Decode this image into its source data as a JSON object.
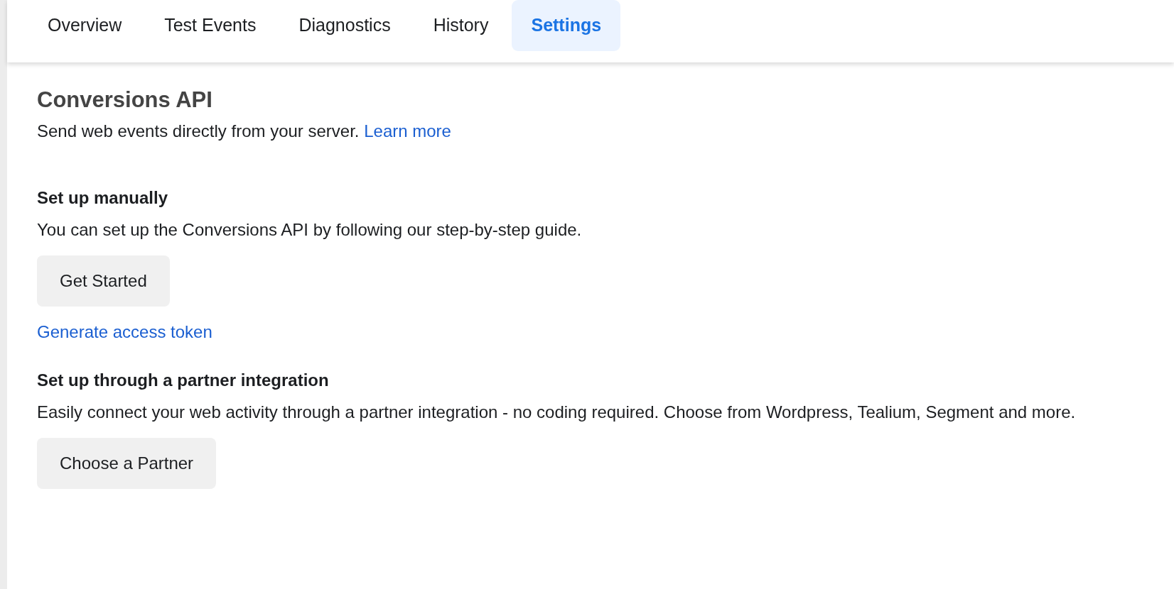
{
  "tabs": [
    {
      "label": "Overview",
      "selected": false
    },
    {
      "label": "Test Events",
      "selected": false
    },
    {
      "label": "Diagnostics",
      "selected": false
    },
    {
      "label": "History",
      "selected": false
    },
    {
      "label": "Settings",
      "selected": true
    }
  ],
  "title": "Conversions API",
  "subtitle": {
    "text": "Send web events directly from your server.",
    "link": "Learn more"
  },
  "sections": [
    {
      "heading": "Set up manually",
      "text": "You can set up the Conversions API by following our step-by-step guide.",
      "button": "Get Started",
      "link": "Generate access token"
    },
    {
      "heading": "Set up through a partner integration",
      "text": "Easily connect your web activity through a partner integration - no coding required. Choose from Wordpress, Tealium, Segment and more.",
      "button": "Choose a Partner"
    }
  ]
}
